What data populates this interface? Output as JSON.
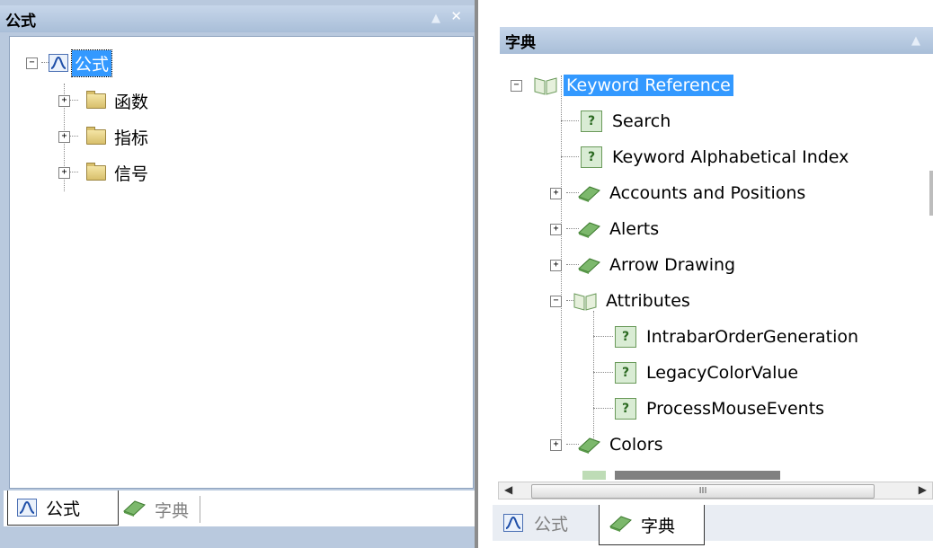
{
  "left": {
    "title": "公式",
    "tree": {
      "root": "公式",
      "children": [
        "函数",
        "指标",
        "信号"
      ]
    },
    "tabs": [
      {
        "label": "公式",
        "active": true,
        "icon": "chart-icon"
      },
      {
        "label": "字典",
        "active": false,
        "icon": "book-icon"
      }
    ]
  },
  "right": {
    "title": "字典",
    "tree": {
      "root": "Keyword Reference",
      "items": [
        "Search",
        "Keyword Alphabetical Index",
        "Accounts and Positions",
        "Alerts",
        "Arrow Drawing",
        "Attributes",
        "IntrabarOrderGeneration",
        "LegacyColorValue",
        "ProcessMouseEvents",
        "Colors"
      ]
    },
    "scroll_thumb": "III",
    "tabs": [
      {
        "label": "公式",
        "active": false,
        "icon": "chart-icon"
      },
      {
        "label": "字典",
        "active": true,
        "icon": "book-icon"
      }
    ]
  }
}
